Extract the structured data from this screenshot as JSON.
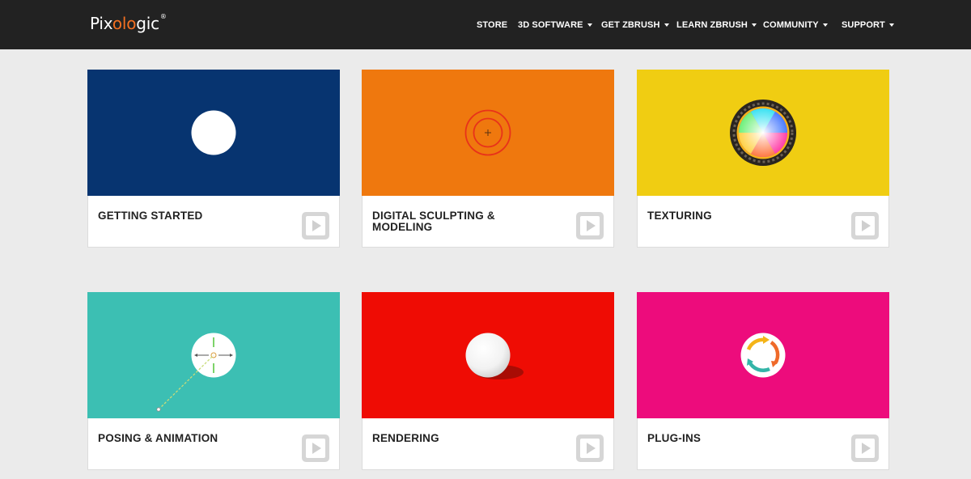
{
  "header": {
    "logo": {
      "pre": "Pix",
      "accent": "olo",
      "post": "gic",
      "tm": "®",
      "accent_color": "#f36f21"
    },
    "nav": [
      {
        "label": "STORE",
        "dropdown": false
      },
      {
        "label": "3D SOFTWARE",
        "dropdown": true
      },
      {
        "label": "GET ZBRUSH",
        "dropdown": true
      },
      {
        "label": "LEARN ZBRUSH",
        "dropdown": true
      },
      {
        "label": "COMMUNITY",
        "dropdown": true
      },
      {
        "label": "SUPPORT",
        "dropdown": true
      }
    ]
  },
  "cards": [
    {
      "title": "GETTING STARTED",
      "color": "#073470",
      "icon": "white-dot-icon"
    },
    {
      "title": "DIGITAL SCULPTING & MODELING",
      "color": "#ef780e",
      "icon": "brush-cursor-icon"
    },
    {
      "title": "TEXTURING",
      "color": "#f0cd12",
      "icon": "color-picker-icon"
    },
    {
      "title": "POSING & ANIMATION",
      "color": "#3cbfb3",
      "icon": "transpose-gizmo-icon"
    },
    {
      "title": "RENDERING",
      "color": "#ef0c04",
      "icon": "rendered-sphere-icon"
    },
    {
      "title": "PLUG-INS",
      "color": "#ed0c7c",
      "icon": "cycle-arrows-icon"
    }
  ]
}
